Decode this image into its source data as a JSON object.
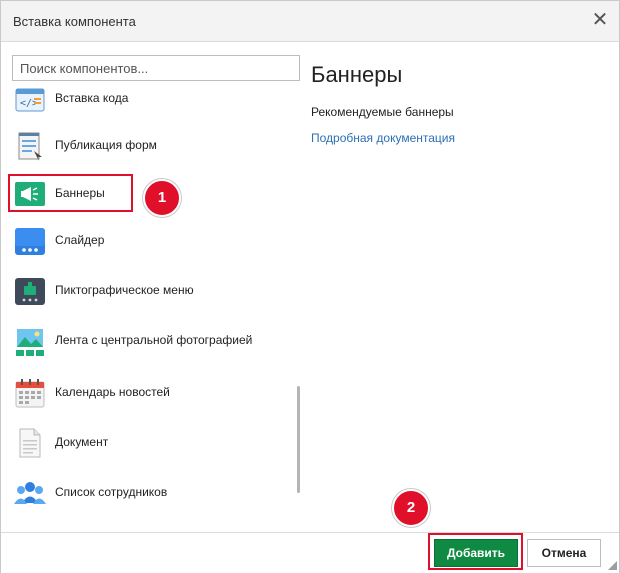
{
  "dialog": {
    "title": "Вставка компонента",
    "close_glyph": "✕"
  },
  "search": {
    "placeholder": "Поиск компонентов..."
  },
  "components": [
    {
      "label": "Вставка кода",
      "icon": "code-icon"
    },
    {
      "label": "Публикация форм",
      "icon": "form-icon"
    },
    {
      "label": "Баннеры",
      "icon": "megaphone-icon"
    },
    {
      "label": "Слайдер",
      "icon": "slider-icon"
    },
    {
      "label": "Пиктографическое меню",
      "icon": "icon-menu-icon"
    },
    {
      "label": "Лента с центральной фотографией",
      "icon": "photo-strip-icon"
    },
    {
      "label": "Календарь новостей",
      "icon": "calendar-icon"
    },
    {
      "label": "Документ",
      "icon": "document-icon"
    },
    {
      "label": "Список сотрудников",
      "icon": "people-icon"
    }
  ],
  "detail": {
    "title": "Баннеры",
    "description": "Рекомендуемые баннеры",
    "link": "Подробная документация"
  },
  "annotations": {
    "step1": "1",
    "step2": "2"
  },
  "footer": {
    "add_label": "Добавить",
    "cancel_label": "Отмена"
  },
  "colors": {
    "add": "#0f8a42",
    "highlight": "#e0102b",
    "link": "#2c6fb5"
  }
}
